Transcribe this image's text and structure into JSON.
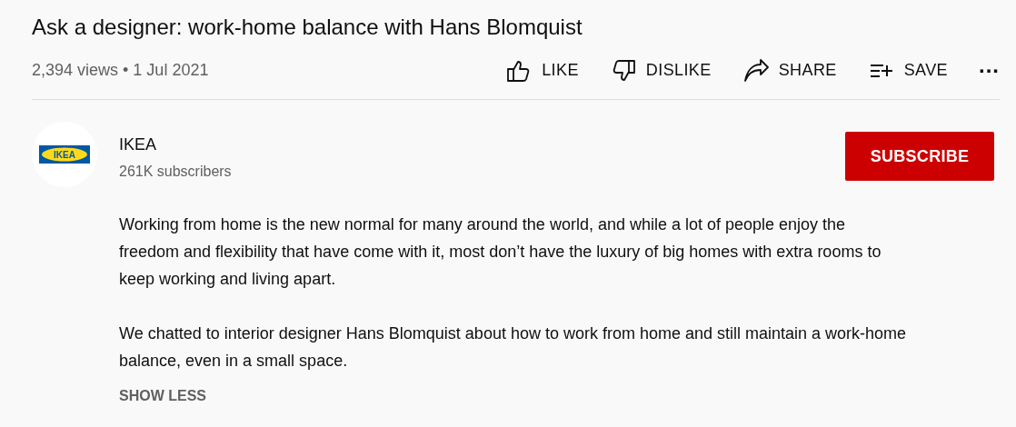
{
  "video": {
    "title": "Ask a designer: work-home balance with Hans Blomquist",
    "views": "2,394 views",
    "separator": "•",
    "date": "1 Jul 2021"
  },
  "actions": [
    {
      "kind": "like",
      "label": "LIKE"
    },
    {
      "kind": "dislike",
      "label": "DISLIKE"
    },
    {
      "kind": "share",
      "label": "SHARE"
    },
    {
      "kind": "save",
      "label": "SAVE"
    },
    {
      "kind": "more",
      "label": "..."
    }
  ],
  "channel": {
    "logo_text": "IKEA",
    "name": "IKEA",
    "subscribers": "261K subscribers",
    "subscribe_label": "SUBSCRIBE"
  },
  "description": {
    "paragraphs": [
      "Working from home is the new normal for many around the world, and while a lot of people enjoy the freedom and flexibility that have come with it, most don’t have the luxury of big homes with extra rooms to keep working and living apart.",
      "We chatted to interior designer Hans Blomquist about how to work from home and still maintain a work-home balance, even in a small space."
    ],
    "toggle_label": "SHOW LESS"
  }
}
